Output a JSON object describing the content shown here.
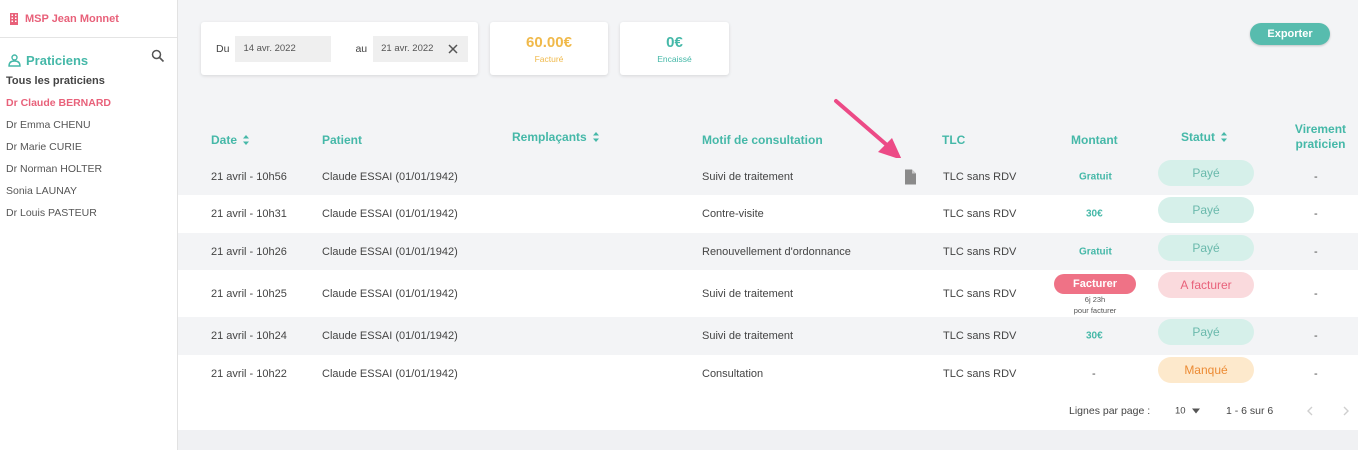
{
  "sidebar": {
    "org_name": "MSP Jean Monnet",
    "section_title": "Praticiens",
    "items": [
      {
        "label": "Tous les praticiens"
      },
      {
        "label": "Dr Claude BERNARD"
      },
      {
        "label": "Dr Emma CHENU"
      },
      {
        "label": "Dr Marie CURIE"
      },
      {
        "label": "Dr Norman HOLTER"
      },
      {
        "label": "Sonia LAUNAY"
      },
      {
        "label": "Dr Louis PASTEUR"
      }
    ],
    "active_color": "#e8617a",
    "accent_color": "#45b8a8"
  },
  "filters": {
    "from_label": "Du",
    "from_value": "14 avr. 2022",
    "to_label": "au",
    "to_value": "21 avr. 2022"
  },
  "stats": {
    "billed_value": "60.00€",
    "billed_label": "Facturé",
    "billed_color": "#f0b94a",
    "cashed_value": "0€",
    "cashed_label": "Encaissé",
    "cashed_color": "#45b8a8"
  },
  "toolbar": {
    "export_label": "Exporter"
  },
  "table": {
    "headers": {
      "date": "Date",
      "patient": "Patient",
      "replacements": "Remplaçants",
      "reason": "Motif de consultation",
      "tlc": "TLC",
      "amount": "Montant",
      "status": "Statut",
      "transfer_line1": "Virement",
      "transfer_line2": "praticien"
    },
    "rows": [
      {
        "date": "21 avril - 10h56",
        "patient": "Claude ESSAI (01/01/1942)",
        "reason": "Suivi de traitement",
        "tlc": "TLC sans RDV",
        "amount": "Gratuit",
        "status": "Payé",
        "transfer": "-"
      },
      {
        "date": "21 avril - 10h31",
        "patient": "Claude ESSAI (01/01/1942)",
        "reason": "Contre-visite",
        "tlc": "TLC sans RDV",
        "amount": "30€",
        "status": "Payé",
        "transfer": "-"
      },
      {
        "date": "21 avril - 10h26",
        "patient": "Claude ESSAI (01/01/1942)",
        "reason": "Renouvellement d'ordonnance",
        "tlc": "TLC sans RDV",
        "amount": "Gratuit",
        "status": "Payé",
        "transfer": "-"
      },
      {
        "date": "21 avril - 10h25",
        "patient": "Claude ESSAI (01/01/1942)",
        "reason": "Suivi de traitement",
        "tlc": "TLC sans RDV",
        "bill_label": "Facturer",
        "bill_sub1": "6j 23h",
        "bill_sub2": "pour facturer",
        "status": "A facturer",
        "transfer": "-"
      },
      {
        "date": "21 avril - 10h24",
        "patient": "Claude ESSAI (01/01/1942)",
        "reason": "Suivi de traitement",
        "tlc": "TLC sans RDV",
        "amount": "30€",
        "status": "Payé",
        "transfer": "-"
      },
      {
        "date": "21 avril - 10h22",
        "patient": "Claude ESSAI (01/01/1942)",
        "reason": "Consultation",
        "tlc": "TLC sans RDV",
        "amount_plain": "-",
        "status": "Manqué",
        "transfer": "-"
      }
    ]
  },
  "pagination": {
    "rows_label": "Lignes par page :",
    "rows_value": "10",
    "range": "1 - 6 sur 6"
  },
  "icons": {
    "org": "building-icon",
    "section": "user-icon",
    "search": "search-icon",
    "clear": "close-icon",
    "sort": "sort-icon",
    "document": "document-icon",
    "dropdown": "caret-down-icon",
    "prev": "chevron-left-icon",
    "next": "chevron-right-icon",
    "annotation": "pointer-arrow-icon"
  }
}
